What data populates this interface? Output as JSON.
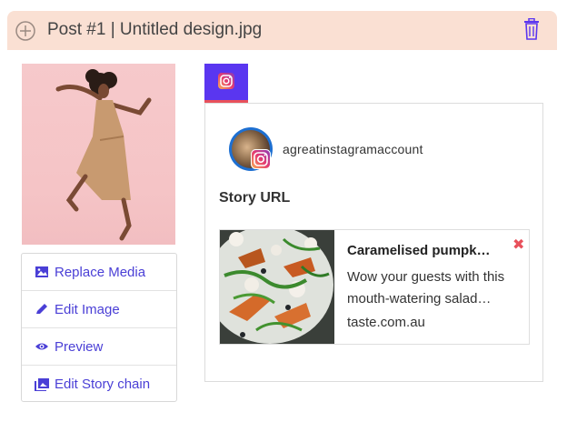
{
  "header": {
    "title": "Post #1 | Untitled design.jpg",
    "add_icon": "add-circle-icon",
    "delete_icon": "trash-icon",
    "background": "#fae0d3"
  },
  "media": {
    "thumbnail_alt": "woman jumping against pink wall"
  },
  "actions": [
    {
      "label": "Replace Media",
      "icon": "image-icon"
    },
    {
      "label": "Edit Image",
      "icon": "pencil-icon"
    },
    {
      "label": "Preview",
      "icon": "eye-icon"
    },
    {
      "label": "Edit Story chain",
      "icon": "gallery-icon"
    }
  ],
  "tabs": [
    {
      "icon": "instagram-icon",
      "active": true
    }
  ],
  "account": {
    "username": "agreatinstagramaccount"
  },
  "story": {
    "label": "Story URL",
    "link": {
      "title": "Caramelised pumpk…",
      "description": "Wow your guests with this mouth-watering salad…",
      "domain": "taste.com.au",
      "remove_icon": "close-icon"
    }
  },
  "colors": {
    "accent": "#4a3fd6",
    "tab": "#5a36f0",
    "tab_underline": "#e8505b",
    "remove": "#e8505b"
  }
}
